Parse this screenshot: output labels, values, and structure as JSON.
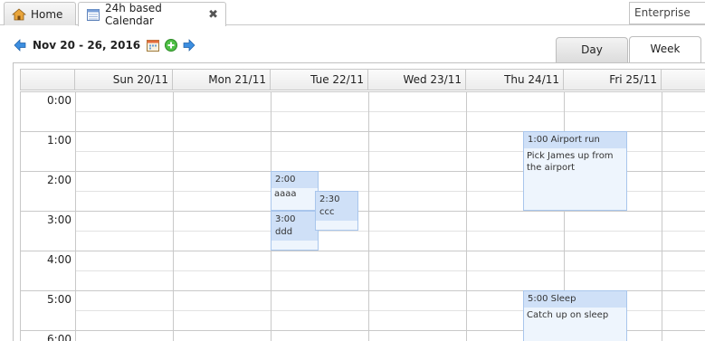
{
  "tabs": {
    "home_label": "Home",
    "calendar_label": "24h based Calendar",
    "enterprise_label": "Enterprise"
  },
  "toolbar": {
    "date_range": "Nov 20 - 26, 2016"
  },
  "views": {
    "day": "Day",
    "week": "Week"
  },
  "calendar": {
    "days": [
      "Sun 20/11",
      "Mon 21/11",
      "Tue 22/11",
      "Wed 23/11",
      "Thu 24/11",
      "Fri 25/11"
    ],
    "times": [
      "0:00",
      "1:00",
      "2:00",
      "3:00",
      "4:00",
      "5:00",
      "6:00"
    ],
    "events": {
      "e1": {
        "title": "2:00",
        "body": "aaaa"
      },
      "e2": {
        "title": "3:00 ddd"
      },
      "e3": {
        "title": "2:30 ccc"
      },
      "e4": {
        "title": "1:00 Airport run",
        "body": "Pick James up from the airport"
      },
      "e5": {
        "title": "5:00 Sleep",
        "body": "Catch up on sleep"
      }
    }
  },
  "colors": {
    "event_bg": "#eef5fd",
    "event_header": "#cfe0f7",
    "event_border": "#a9c6ec"
  }
}
